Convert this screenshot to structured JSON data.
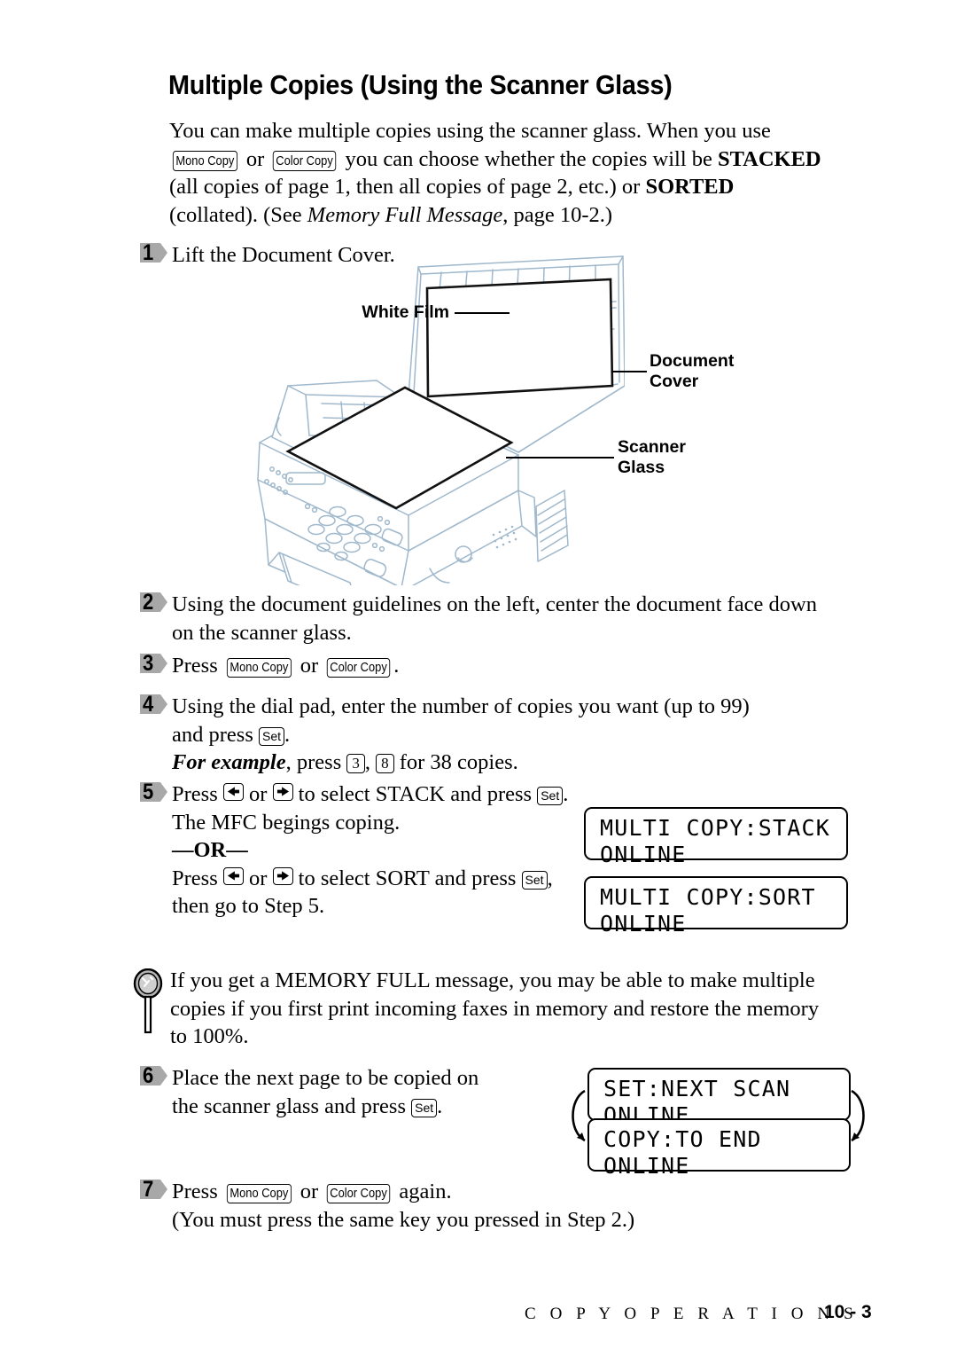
{
  "document": {
    "title": "Multiple Copies (Using the Scanner Glass)",
    "intro": {
      "line1": "You can make multiple copies using the scanner glass. When you use",
      "key_mono": "Mono Copy",
      "or": "or",
      "key_color": "Color Copy",
      "line2_after": "you can choose whether the copies will be",
      "stacked": "STACKED",
      "line3a": "(all copies of page 1, then all copies of page 2, etc.) or",
      "sorted": "SORTED",
      "line4a": "(collated). (See",
      "ref_italic": "Memory Full Message",
      "line4b": ", page 10-2.)"
    }
  },
  "illustration": {
    "labels": {
      "white_film": "White Film",
      "document_cover": "Document\nCover",
      "scanner_glass": "Scanner\nGlass"
    }
  },
  "steps": [
    {
      "number": "1",
      "text": "Lift the Document Cover."
    },
    {
      "number": "2",
      "line1": "Using the document guidelines on the left, center the document face down",
      "line2": "on the scanner glass."
    },
    {
      "number": "3",
      "press": "Press",
      "key_mono": "Mono Copy",
      "or": "or",
      "key_color": "Color Copy",
      "period": "."
    },
    {
      "number": "4",
      "line1": "Using the dial pad, enter the number of copies you want (up to 99)",
      "line2a": "and press",
      "key_set": "Set",
      "line2b": ".",
      "example_label": "For example",
      "line3a": ", press",
      "key_3": "3",
      "comma": ",",
      "key_8": "8",
      "line3b": "for 38 copies."
    },
    {
      "number": "5",
      "press": "Press",
      "key_left": "left-arrow",
      "or": "or",
      "key_right": "right-arrow",
      "select_stack": "to select STACK and press",
      "key_set": "Set",
      "period": ".",
      "mfc_line": "The MFC begings coping.",
      "or_divider": "—OR—",
      "press2": "Press",
      "select_sort": "to select SORT and press",
      "key_set2": "Set",
      "comma": ",",
      "then_line": "then go to Step 5."
    },
    {
      "number": "6",
      "line1": "Place the next page to be copied on",
      "line2a": "the scanner glass and press",
      "key_set": "Set",
      "line2b": "."
    },
    {
      "number": "7",
      "press": "Press",
      "key_mono": "Mono Copy",
      "or": "or",
      "key_color": "Color Copy",
      "again": "again.",
      "line2": "(You must press the same key you pressed in Step 2.)"
    }
  ],
  "note": {
    "icon": "magnifier-icon",
    "line1": "If you get a MEMORY FULL message, you may be able to make multiple",
    "line2": "copies if you first print incoming faxes in memory and restore the memory",
    "line3": "to 100%."
  },
  "lcd_displays": [
    {
      "id": "stack",
      "line1": "MULTI COPY:STACK",
      "line2": "ONLINE"
    },
    {
      "id": "sort",
      "line1": "MULTI COPY:SORT",
      "line2": "ONLINE"
    },
    {
      "id": "next_scan",
      "line1": "SET:NEXT SCAN",
      "line2": "ONLINE"
    },
    {
      "id": "copy_to_end",
      "line1": "COPY:TO END",
      "line2": "ONLINE"
    }
  ],
  "footer": {
    "section": "C O P Y   O P E R A T I O N S",
    "page_number": "10 - 3"
  },
  "colors": {
    "text": "#000000",
    "marker_gray": "#a8a8a8",
    "illustration_line": "#9fb8cc",
    "lens_gray": "#b5b5b5"
  }
}
